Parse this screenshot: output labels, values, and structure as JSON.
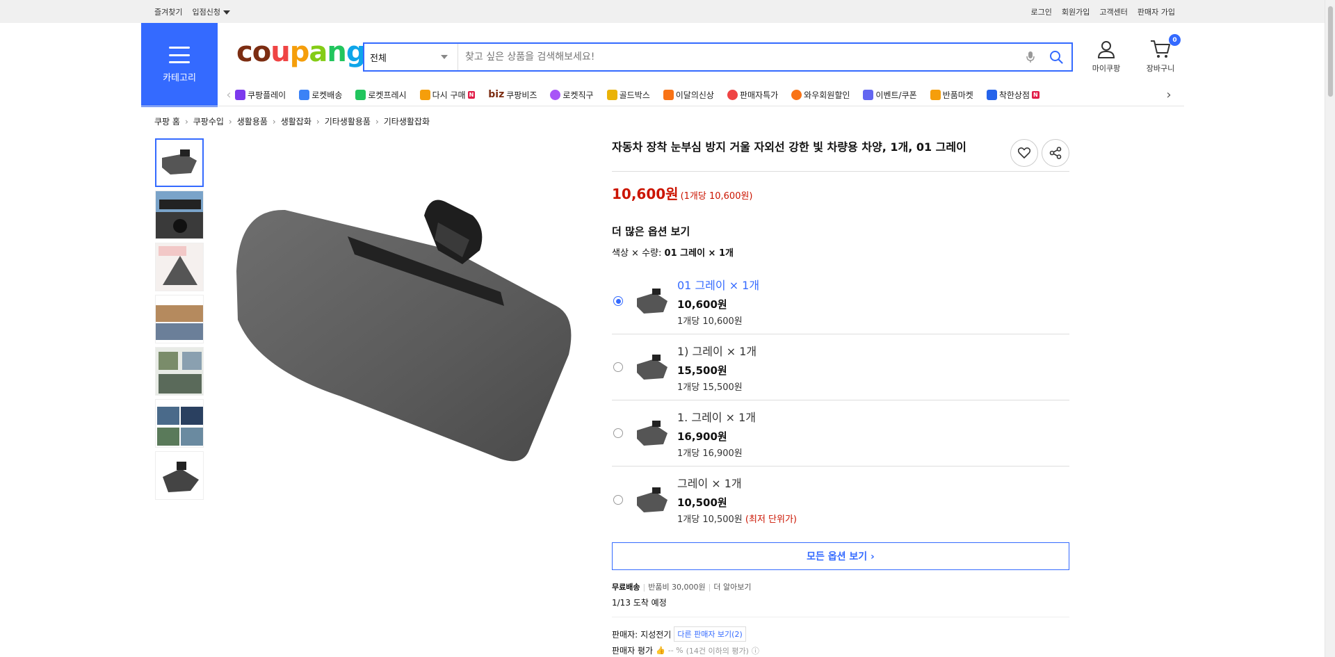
{
  "topbar": {
    "bookmark": "즐겨찾기",
    "seller_apply": "입점신청",
    "login": "로그인",
    "signup": "회원가입",
    "customer_center": "고객센터",
    "seller_signup": "판매자 가입"
  },
  "category_button": {
    "label": "카테고리"
  },
  "logo": {
    "letters": [
      "c",
      "o",
      "u",
      "p",
      "a",
      "n",
      "g"
    ]
  },
  "search": {
    "category": "전체",
    "placeholder": "찾고 싶은 상품을 검색해보세요!"
  },
  "user_menu": {
    "mycoupang": "마이쿠팡",
    "cart": "장바구니",
    "cart_count": "0"
  },
  "nav": [
    {
      "label": "쿠팡플레이",
      "color": "#7c3aed"
    },
    {
      "label": "로켓배송",
      "color": "#3b82f6"
    },
    {
      "label": "로켓프레시",
      "color": "#22c55e"
    },
    {
      "label": "다시 구매",
      "color": "#f59e0b",
      "new": "N"
    },
    {
      "label": "쿠팡비즈",
      "prefix": "biz"
    },
    {
      "label": "로켓직구",
      "color": "#a855f7"
    },
    {
      "label": "골드박스",
      "color": "#eab308"
    },
    {
      "label": "이달의신상",
      "color": "#f97316"
    },
    {
      "label": "판매자특가",
      "color": "#ef4444"
    },
    {
      "label": "와우회원할인",
      "color": "#f97316"
    },
    {
      "label": "이벤트/쿠폰",
      "color": "#6366f1"
    },
    {
      "label": "반품마켓",
      "color": "#f59e0b"
    },
    {
      "label": "착한상점",
      "color": "#2563eb",
      "new": "N"
    }
  ],
  "breadcrumbs": [
    "쿠팡 홈",
    "쿠팡수입",
    "생활용품",
    "생활잡화",
    "기타생활용품",
    "기타생활잡화"
  ],
  "product": {
    "title": "자동차 장착 눈부심 방지 거울 자외선 강한 빛 차량용 차양, 1개, 01 그레이",
    "price": "10,600원",
    "unit_price": "(1개당 10,600원)",
    "more_options": "더 많은 옵션 보기",
    "selected_label": "색상 × 수량:",
    "selected_value": "01 그레이 × 1개",
    "options": [
      {
        "name": "01 그레이 × 1개",
        "price": "10,600원",
        "unit": "1개당 10,600원",
        "selected": true,
        "low": ""
      },
      {
        "name": "1) 그레이 × 1개",
        "price": "15,500원",
        "unit": "1개당 15,500원",
        "selected": false,
        "low": ""
      },
      {
        "name": "1. 그레이 × 1개",
        "price": "16,900원",
        "unit": "1개당 16,900원",
        "selected": false,
        "low": ""
      },
      {
        "name": "그레이 × 1개",
        "price": "10,500원",
        "unit": "1개당 10,500원",
        "selected": false,
        "low": "(최저 단위가)"
      }
    ],
    "all_options": "모든 옵션 보기 ›",
    "shipping": {
      "free": "무료배송",
      "return_fee": "반품비 30,000원",
      "more": "더 알아보기",
      "arrival": "1/13 도착 예정"
    },
    "seller": {
      "label": "판매자:",
      "name": "지성전기",
      "other": "다른 판매자 보기(2)",
      "rating_label": "판매자 평가",
      "rating": "-- %",
      "rating_note": "(14건 이하의 평가)"
    }
  }
}
